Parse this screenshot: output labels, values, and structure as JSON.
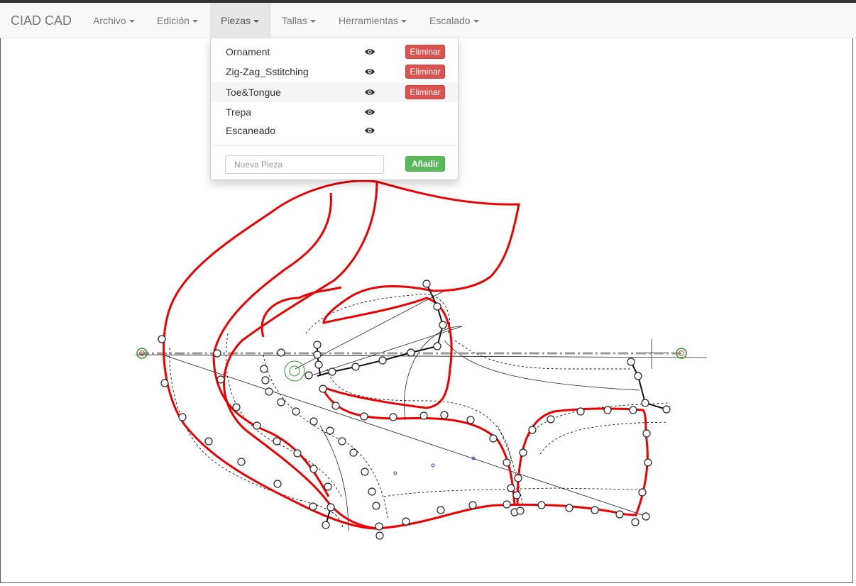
{
  "app": {
    "brand": "CIAD CAD"
  },
  "menu": {
    "archivo": "Archivo",
    "edicion": "Edición",
    "piezas": "Piezas",
    "tallas": "Tallas",
    "herramientas": "Herramientas",
    "escalado": "Escalado"
  },
  "pieces_menu": {
    "items": [
      {
        "name": "Ornament",
        "delete_label": "Eliminar",
        "icon": "eye-icon"
      },
      {
        "name": "Zig-Zag_Sstitching",
        "delete_label": "Eliminar",
        "icon": "eye-icon"
      },
      {
        "name": "Toe&Tongue",
        "delete_label": "Eliminar",
        "icon": "eye-icon"
      },
      {
        "name": "Trepa",
        "icon": "eye-icon"
      },
      {
        "name": "Escaneado",
        "icon": "eye-icon"
      }
    ],
    "new_piece_placeholder": "Nueva Pieza",
    "new_piece_value": "",
    "add_label": "Añadir"
  },
  "colors": {
    "pattern_outline": "#ee0000",
    "danger_button": "#d9534f",
    "success_button": "#5cb85c",
    "navbar_bg": "#f8f8f8",
    "axis_dash": "#999999",
    "marker_green": "#2a9a2a"
  }
}
